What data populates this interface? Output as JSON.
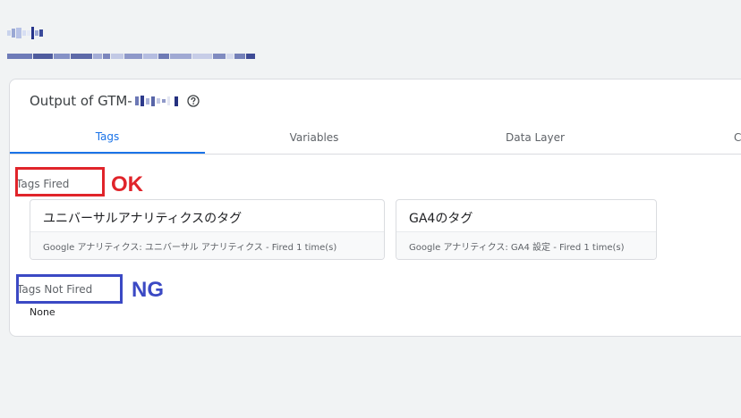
{
  "header": {
    "title_prefix": "Output of GTM-",
    "help_icon": "help-circle-icon"
  },
  "tabs": [
    {
      "label": "Tags",
      "active": true
    },
    {
      "label": "Variables",
      "active": false
    },
    {
      "label": "Data Layer",
      "active": false
    },
    {
      "label": "C",
      "active": false
    }
  ],
  "sections": {
    "fired": {
      "label": "Tags Fired",
      "tags": [
        {
          "name": "ユニバーサルアナリティクスのタグ",
          "detail": "Google アナリティクス: ユニバーサル アナリティクス - Fired 1 time(s)"
        },
        {
          "name": "GA4のタグ",
          "detail": "Google アナリティクス: GA4 設定 - Fired 1 time(s)"
        }
      ]
    },
    "not_fired": {
      "label": "Tags Not Fired",
      "empty_text": "None"
    }
  },
  "annotations": {
    "ok": {
      "text": "OK",
      "color": "#e0242a"
    },
    "ng": {
      "text": "NG",
      "color": "#3b49c4"
    }
  },
  "colors": {
    "accent": "#1a73e8",
    "page_bg": "#f1f3f4"
  }
}
